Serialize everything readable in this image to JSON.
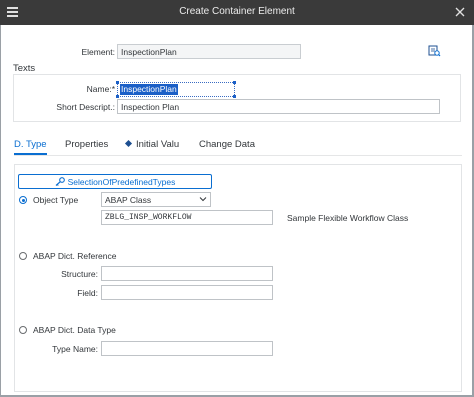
{
  "window": {
    "title": "Create Container Element"
  },
  "header": {
    "element_label": "Element:",
    "element_value": "InspectionPlan"
  },
  "texts": {
    "section_title": "Texts",
    "name_label": "Name:*",
    "name_value": "InspectionPlan",
    "short_label": "Short Descript.:",
    "short_value": "Inspection Plan"
  },
  "tabs": [
    {
      "label": "D. Type",
      "active": true
    },
    {
      "label": "Properties",
      "active": false
    },
    {
      "label": "Initial Valu",
      "active": false
    },
    {
      "label": "Change Data",
      "active": false
    }
  ],
  "dtype": {
    "predefined_button": "SelectionOfPredefinedTypes",
    "object_type": {
      "label": "Object Type",
      "selected": true,
      "category_value": "ABAP Class",
      "class_value": "ZBLG_INSP_WORKFLOW",
      "class_description": "Sample Flexible Workflow Class"
    },
    "abap_dict_ref": {
      "label": "ABAP Dict. Reference",
      "selected": false,
      "structure_label": "Structure:",
      "structure_value": "",
      "field_label": "Field:",
      "field_value": ""
    },
    "abap_dict_type": {
      "label": "ABAP Dict. Data Type",
      "selected": false,
      "type_name_label": "Type Name:",
      "type_name_value": ""
    }
  },
  "icons": {
    "menu": "app-menu-icon",
    "close": "close-icon",
    "details": "details-icon",
    "predefined": "key-icon",
    "dropdown": "chevron-down-icon"
  },
  "colors": {
    "titlebar": "#3a3a3a",
    "accent": "#0a6ed1",
    "selection": "#1a5fc7"
  }
}
